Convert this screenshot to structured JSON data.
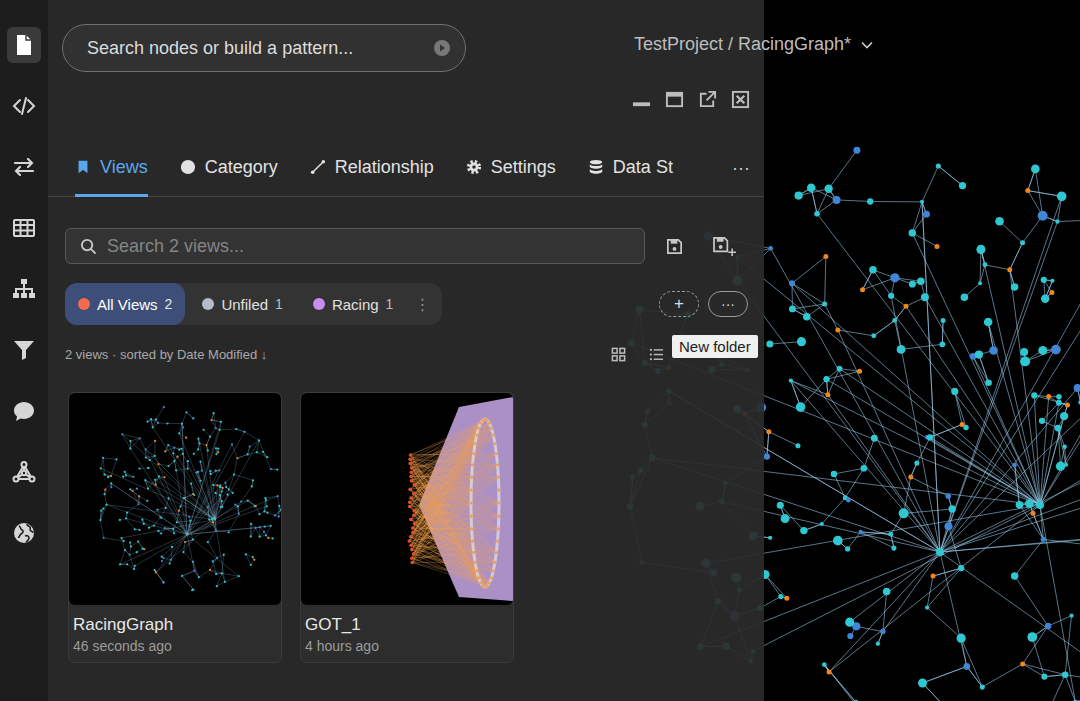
{
  "breadcrumb": "TestProject / RacingGraph*",
  "search": {
    "placeholder": "Search nodes or build a pattern..."
  },
  "rail": [
    {
      "selected": true
    },
    {
      "selected": false
    },
    {
      "selected": false
    },
    {
      "selected": false
    },
    {
      "selected": false
    },
    {
      "selected": false
    },
    {
      "selected": false
    },
    {
      "selected": false
    },
    {
      "selected": false
    }
  ],
  "tabs": [
    {
      "label": "Views",
      "selected": true
    },
    {
      "label": "Category",
      "selected": false
    },
    {
      "label": "Relationship",
      "selected": false
    },
    {
      "label": "Settings",
      "selected": false
    },
    {
      "label": "Data St",
      "selected": false
    }
  ],
  "tabs_more": "···",
  "views_search": {
    "placeholder": "Search 2 views..."
  },
  "folders": [
    {
      "label": "All Views",
      "count": "2",
      "color": "#f26b4f",
      "selected": true
    },
    {
      "label": "Unfiled",
      "count": "1",
      "color": "#b4bccb",
      "selected": false
    },
    {
      "label": "Racing",
      "count": "1",
      "color": "#c98cf0",
      "selected": false
    }
  ],
  "folder_menu": "⋮",
  "new_folder": {
    "icon": "+",
    "tooltip": "New folder"
  },
  "more_button": "···",
  "summary": "2 views · sorted by Date Modified ↓",
  "views": [
    {
      "title": "RacingGraph",
      "time": "46 seconds ago",
      "kind": "sphere"
    },
    {
      "title": "GOT_1",
      "time": "4 hours ago",
      "kind": "fan"
    }
  ]
}
